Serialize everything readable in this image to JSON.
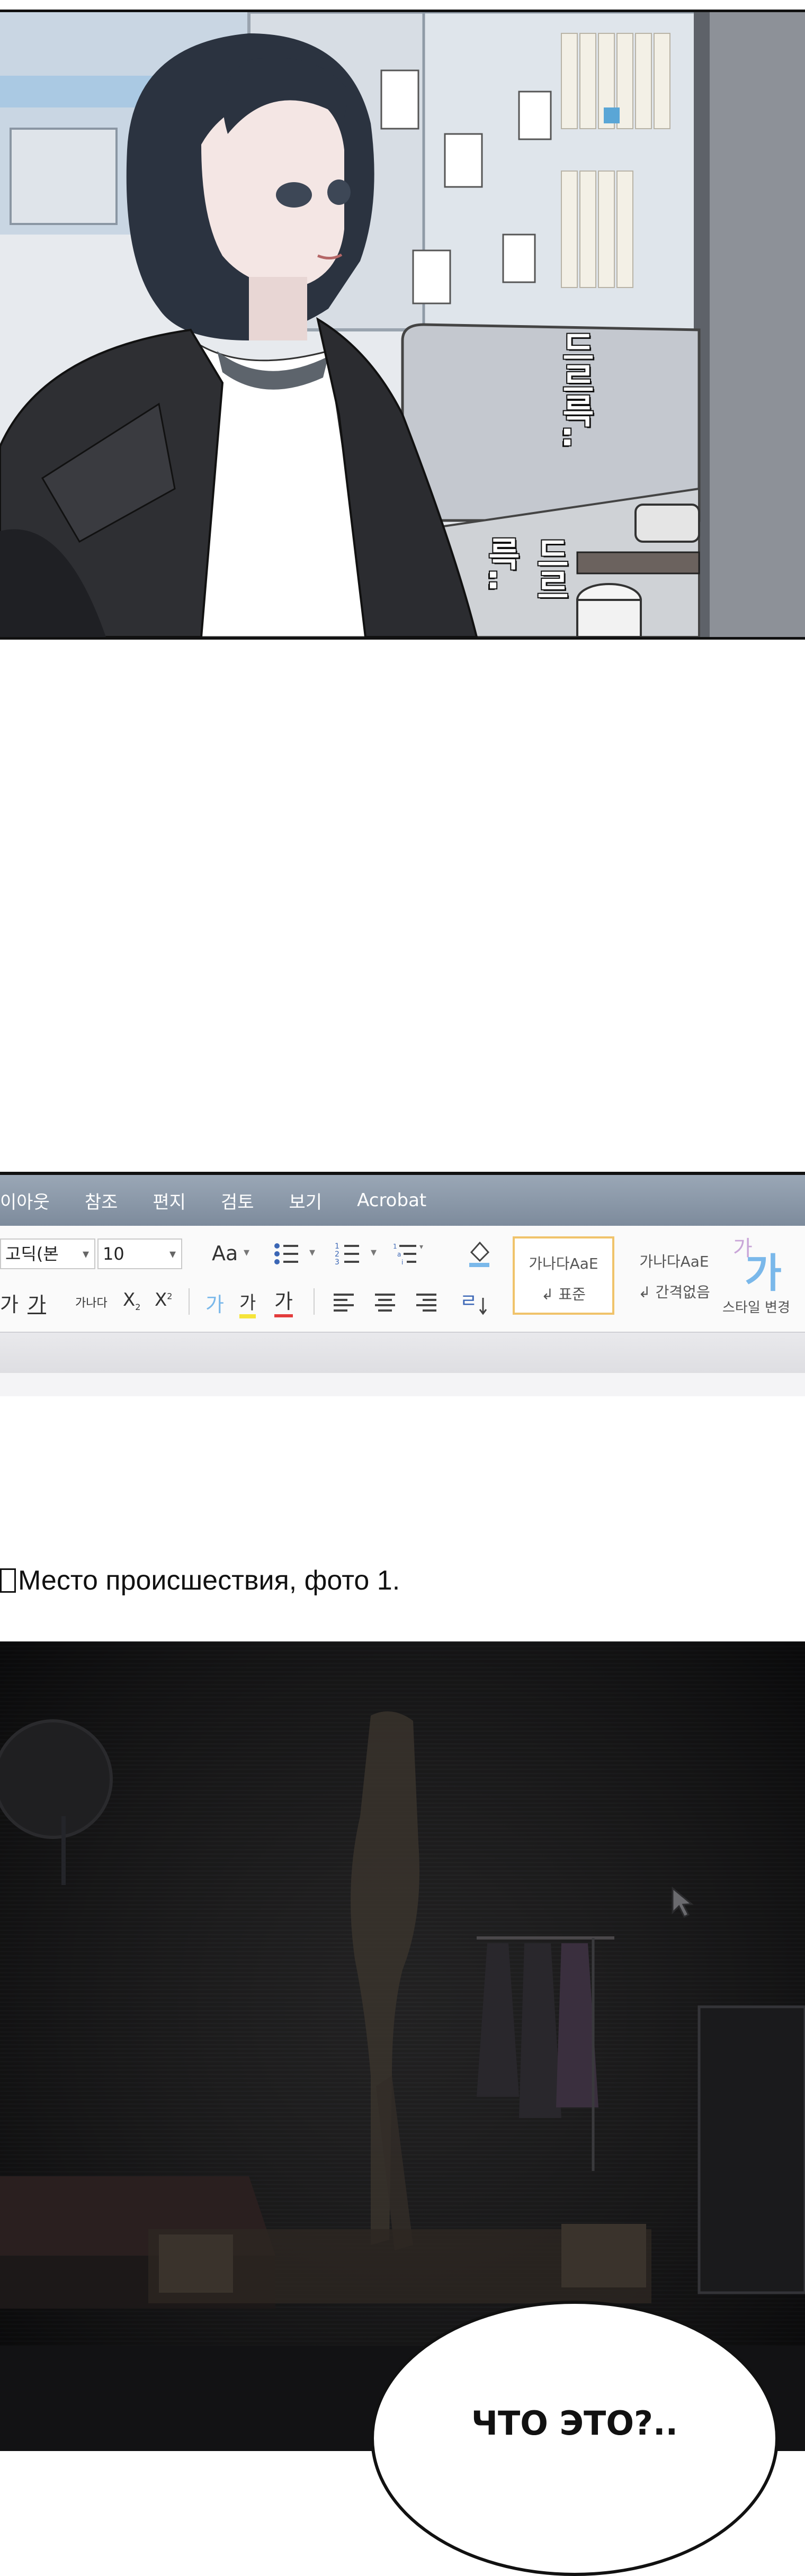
{
  "panel1": {
    "sfx_top": "드르륵..",
    "sfx_bottom": "드르륵.."
  },
  "ribbon": {
    "menu": [
      "이아웃",
      "참조",
      "편지",
      "검토",
      "보기",
      "Acrobat"
    ],
    "font_name": "고딕(본",
    "font_size": "10",
    "case_label": "Aa",
    "row2": {
      "ga1": "가",
      "ga2": "가",
      "ganada": "가나다",
      "sub": "X",
      "sub_mark": "2",
      "sup": "X",
      "sup_mark": "2",
      "highlight": "가",
      "fontcolor_ga": "가",
      "fontcolor_ga2": "가"
    },
    "styles": {
      "normal_preview": "가나다AaE",
      "normal_label": "↲ 표준",
      "nospacing_preview": "가나다AaE",
      "nospacing_label": "↲ 간격없음",
      "change_small": "가",
      "change_big": "가",
      "change_label": "스타일 변경"
    },
    "colors": {
      "menubar": "#8796a7",
      "style_border": "#f0c36b",
      "accent_blue": "#7ab8ea",
      "highlight_yellow": "#f5e43a",
      "fontcolor_red": "#e33c3c"
    }
  },
  "document": {
    "caption": "Место происшествия, фото 1."
  },
  "bubble": {
    "text": "ЧТО ЭТО?.."
  },
  "icons": [
    "bullet-list-icon",
    "numbered-list-icon",
    "multilevel-list-icon",
    "paint-bucket-icon",
    "align-left-icon",
    "align-center-icon",
    "align-right-icon",
    "line-spacing-icon",
    "mouse-cursor-icon"
  ]
}
